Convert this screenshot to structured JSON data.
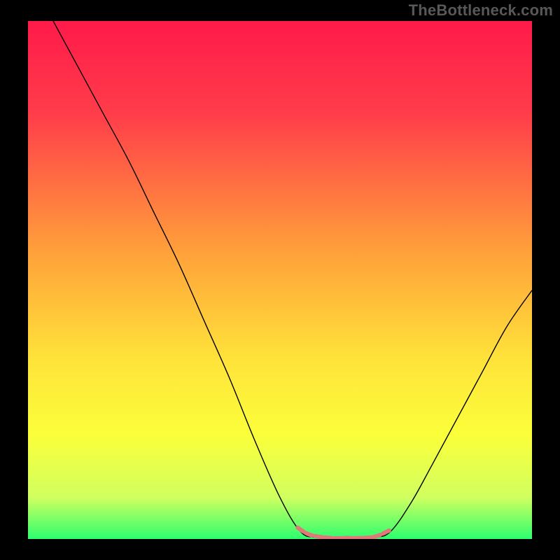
{
  "watermark": "TheBottleneck.com",
  "chart_data": {
    "type": "line",
    "title": "",
    "xlabel": "",
    "ylabel": "",
    "xlim": [
      0,
      100
    ],
    "ylim": [
      0,
      100
    ],
    "background_gradient": {
      "stops": [
        {
          "offset": 0,
          "color": "#ff1a4a"
        },
        {
          "offset": 18,
          "color": "#ff3d4a"
        },
        {
          "offset": 45,
          "color": "#ffa23a"
        },
        {
          "offset": 65,
          "color": "#ffe23a"
        },
        {
          "offset": 80,
          "color": "#fbff3a"
        },
        {
          "offset": 92,
          "color": "#d0ff60"
        },
        {
          "offset": 100,
          "color": "#2dff6e"
        }
      ]
    },
    "series": [
      {
        "name": "bottleneck-curve",
        "color": "#000000",
        "stroke_width": 1.4,
        "points": [
          {
            "x": 5,
            "y": 100
          },
          {
            "x": 10,
            "y": 91
          },
          {
            "x": 15,
            "y": 82
          },
          {
            "x": 20,
            "y": 73
          },
          {
            "x": 25,
            "y": 63
          },
          {
            "x": 30,
            "y": 53
          },
          {
            "x": 35,
            "y": 42
          },
          {
            "x": 40,
            "y": 31
          },
          {
            "x": 45,
            "y": 19
          },
          {
            "x": 50,
            "y": 8
          },
          {
            "x": 54,
            "y": 1.5
          },
          {
            "x": 57,
            "y": 0.3
          },
          {
            "x": 60,
            "y": 0
          },
          {
            "x": 63,
            "y": 0
          },
          {
            "x": 66,
            "y": 0
          },
          {
            "x": 69,
            "y": 0.3
          },
          {
            "x": 72,
            "y": 1.5
          },
          {
            "x": 76,
            "y": 7
          },
          {
            "x": 80,
            "y": 14
          },
          {
            "x": 85,
            "y": 23
          },
          {
            "x": 90,
            "y": 32
          },
          {
            "x": 95,
            "y": 41
          },
          {
            "x": 100,
            "y": 48
          }
        ]
      }
    ],
    "highlight_band": {
      "name": "optimal-zone",
      "color": "#e07a7a",
      "stroke_width": 6,
      "dash": "10,4",
      "points": [
        {
          "x": 53.5,
          "y": 2.2
        },
        {
          "x": 56,
          "y": 0.8
        },
        {
          "x": 60,
          "y": 0.2
        },
        {
          "x": 63,
          "y": 0.2
        },
        {
          "x": 66,
          "y": 0.2
        },
        {
          "x": 69,
          "y": 0.5
        },
        {
          "x": 72,
          "y": 1.8
        }
      ]
    }
  }
}
